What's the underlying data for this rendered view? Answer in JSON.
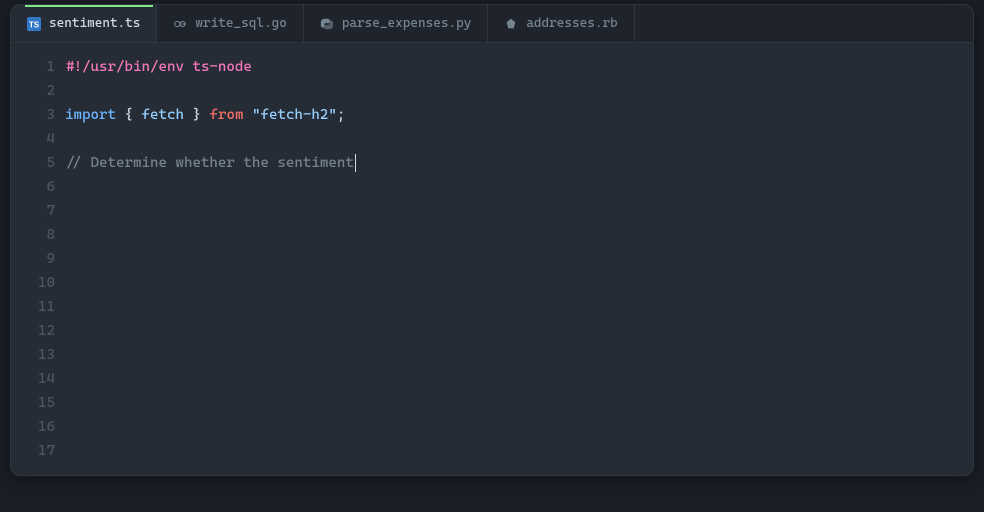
{
  "tabs": [
    {
      "label": "sentiment.ts",
      "active": true,
      "icon": "ts-file-icon"
    },
    {
      "label": "write_sql.go",
      "active": false,
      "icon": "go-file-icon"
    },
    {
      "label": "parse_expenses.py",
      "active": false,
      "icon": "py-file-icon"
    },
    {
      "label": "addresses.rb",
      "active": false,
      "icon": "rb-file-icon"
    }
  ],
  "gutter": [
    "1",
    "2",
    "3",
    "4",
    "5",
    "6",
    "7",
    "8",
    "9",
    "10",
    "11",
    "12",
    "13",
    "14",
    "15",
    "16",
    "17"
  ],
  "code": {
    "line1": {
      "shebang": "#!/usr/bin/env ts-node"
    },
    "line3": {
      "import_kw": "import",
      "brace_open": " { ",
      "ident": "fetch",
      "brace_close": " } ",
      "from_kw": "from",
      "space": " ",
      "string": "\"fetch-h2\"",
      "semi": ";"
    },
    "line5": {
      "comment": "// Determine whether the sentiment"
    }
  }
}
